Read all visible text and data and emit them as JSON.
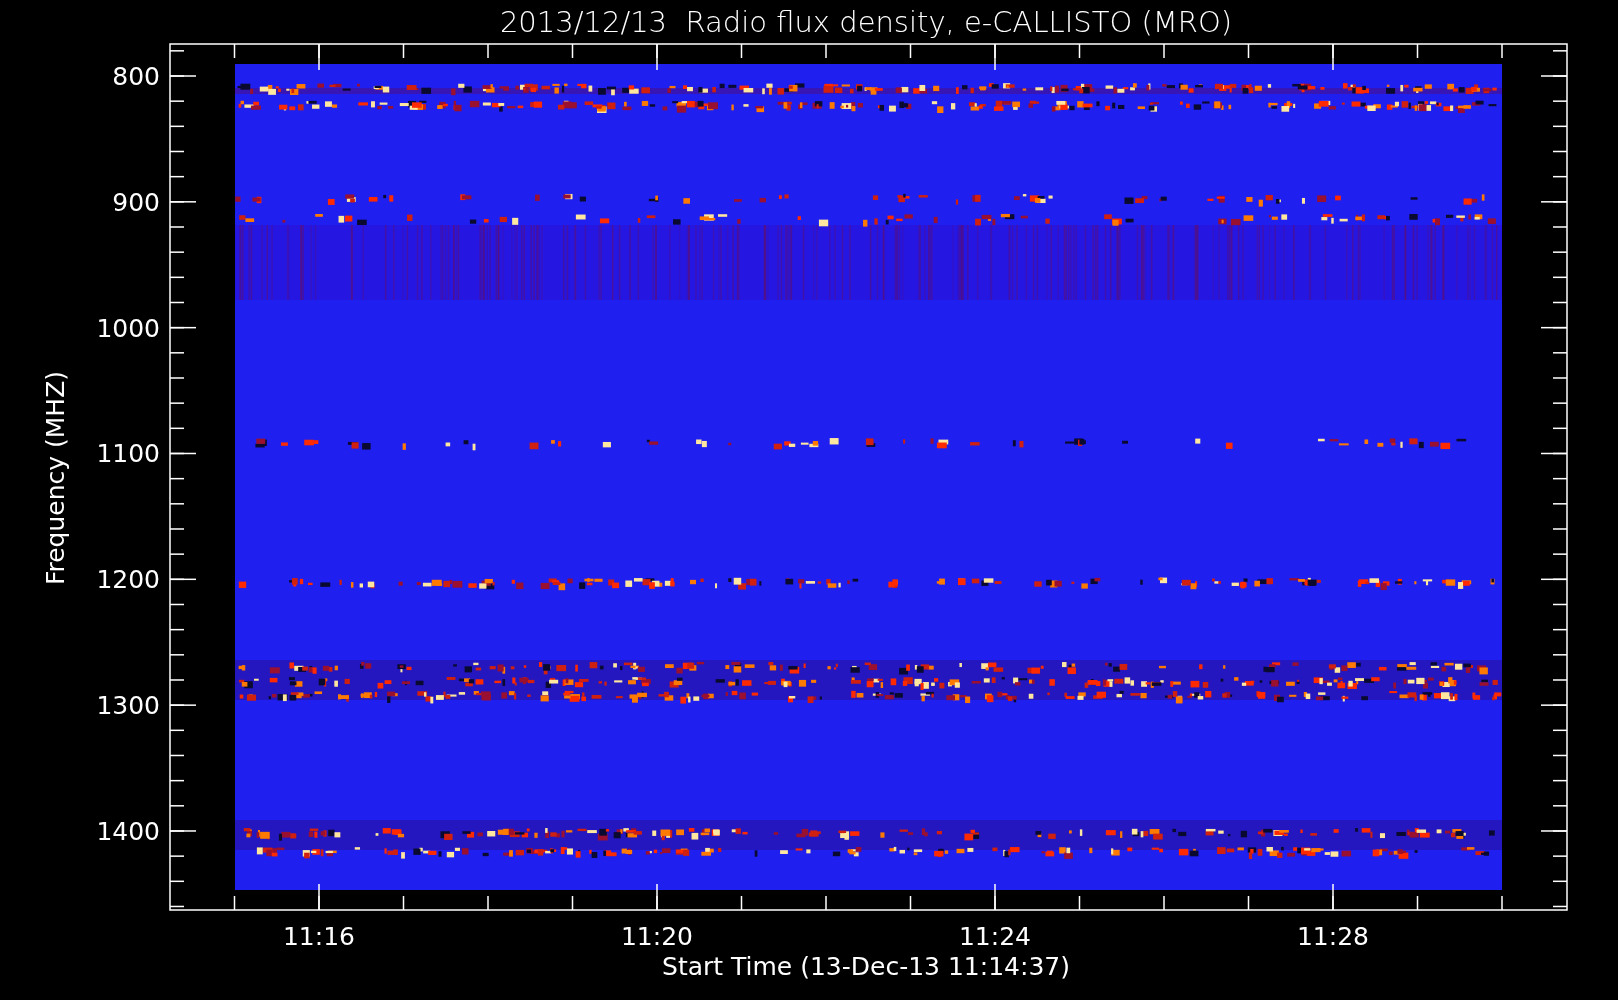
{
  "title": "2013/12/13  Radio flux density, e-CALLISTO (MRO)",
  "y_axis": {
    "label": "Frequency (MHZ)",
    "ticks": [
      "800",
      "900",
      "1000",
      "1100",
      "1200",
      "1300",
      "1400"
    ]
  },
  "x_axis": {
    "label": "Start Time (13-Dec-13 11:14:37)",
    "ticks": [
      "11:16",
      "11:20",
      "11:24",
      "11:28"
    ]
  }
}
